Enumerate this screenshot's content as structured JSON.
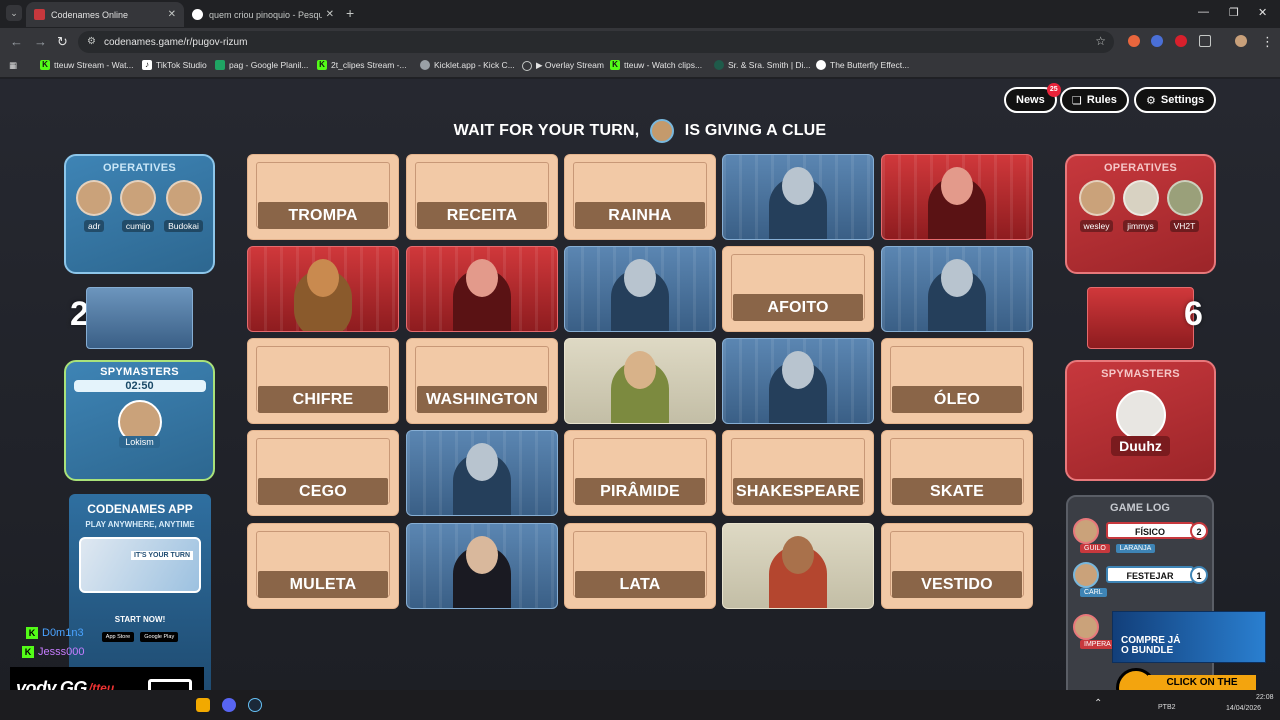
{
  "browser": {
    "tabs": [
      {
        "title": "Codenames Online",
        "active": true
      },
      {
        "title": "quem criou pinoquio - Pesquisa",
        "active": false
      }
    ],
    "url": "codenames.game/r/pugov-rizum",
    "bookmarks": [
      "tteuw Stream - Wat...",
      "TikTok Studio",
      "pag - Google Planil...",
      "2t_clipes Stream -...",
      "Kicklet.app - Kick C...",
      "▶ Overlay Stream",
      "tteuw - Watch clips...",
      "Sr. & Sra. Smith | Di...",
      "The Butterfly Effect..."
    ]
  },
  "header": {
    "news_label": "News",
    "news_count": "25",
    "rules_label": "Rules",
    "settings_label": "Settings",
    "turn_message_prefix": "WAIT FOR YOUR TURN,",
    "turn_message_suffix": "IS GIVING A CLUE",
    "turn_player": "Lokism"
  },
  "blue_team": {
    "operatives_title": "OPERATIVES",
    "operatives": [
      "adr",
      "cumijo",
      "Budokai"
    ],
    "score": "2",
    "spymasters_title": "SPYMASTERS",
    "timer": "02:50",
    "spymaster": "Lokism"
  },
  "red_team": {
    "operatives_title": "OPERATIVES",
    "operatives": [
      "wesley",
      "jimmys",
      "VH2T"
    ],
    "score": "6",
    "spymasters_title": "SPYMASTERS",
    "spymaster": "Duuhz"
  },
  "promo": {
    "title": "CODENAMES APP",
    "subtitle": "PLAY ANYWHERE, ANYTIME",
    "phone_text": "IT'S YOUR TURN",
    "cta": "START NOW!",
    "store1": "App Store",
    "store2": "Google Play"
  },
  "board": {
    "words": {
      "c0": "TROMPA",
      "c1": "RECEITA",
      "c2": "RAINHA",
      "c8": "AFOITO",
      "c10": "CHIFRE",
      "c11": "WASHINGTON",
      "c14": "ÓLEO",
      "c15": "CEGO",
      "c17": "PIRÂMIDE",
      "c18": "SHAKESPEARE",
      "c19": "SKATE",
      "c20": "MULETA",
      "c22": "LATA",
      "c24": "VESTIDO"
    },
    "revealed": {
      "c3": "blue",
      "c4": "red",
      "c5": "red",
      "c6": "red",
      "c7": "blue",
      "c9": "blue",
      "c12": "neutral",
      "c13": "blue",
      "c16": "blue",
      "c21": "blue",
      "c23": "neutral"
    }
  },
  "game_log": {
    "title": "GAME LOG",
    "entries": [
      {
        "player": "Duuhz",
        "clue": "FÍSICO",
        "number": "2",
        "team": "red",
        "guesses": [
          "GUILO",
          "LARANJA"
        ]
      },
      {
        "player": "Lokism",
        "clue": "FESTEJAR",
        "number": "1",
        "team": "blue",
        "guesses": [
          "CARL"
        ]
      },
      {
        "player": "Duuhz",
        "clue": "",
        "number": "",
        "team": "red",
        "guesses": [
          "IMPERA"
        ]
      }
    ]
  },
  "overlay": {
    "chat": [
      {
        "user": "D0m1n3",
        "color": "#4aa3ff"
      },
      {
        "user": "Jesss000",
        "color": "#c77dff"
      }
    ],
    "vody_brand": "vody.GG",
    "vody_handle": "/tteu",
    "ad_line1": "COMPRE JÁ",
    "ad_line2": "O BUNDLE",
    "banner_text": "CLICK ON THE BANNER BELOW"
  },
  "taskbar": {
    "lang": "PTB2",
    "time": "22:08",
    "date": "14/04/2026"
  }
}
